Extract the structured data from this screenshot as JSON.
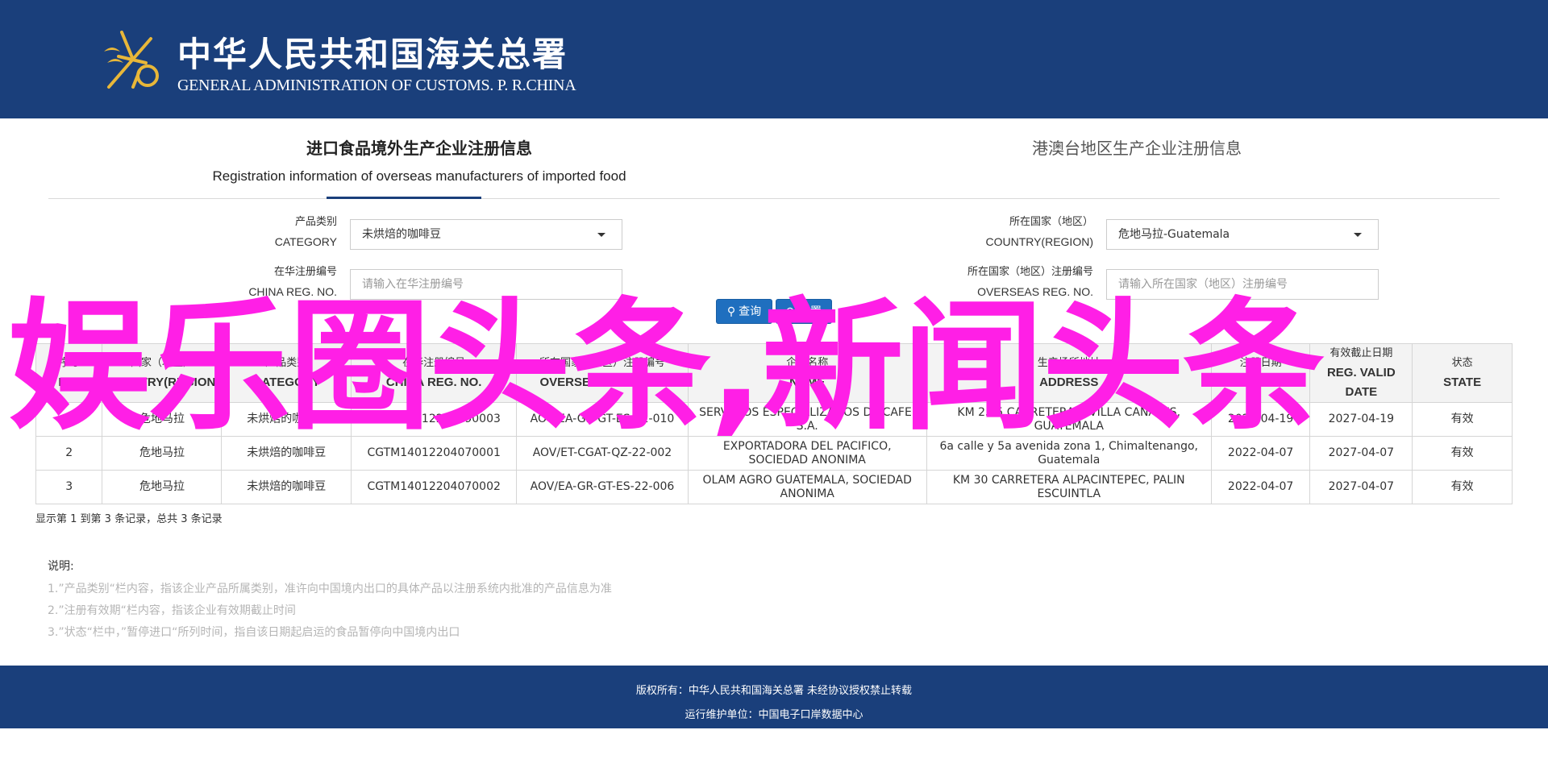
{
  "header": {
    "title_cn": "中华人民共和国海关总署",
    "title_en": "GENERAL ADMINISTRATION OF CUSTOMS. P. R.CHINA"
  },
  "tabs": [
    {
      "cn": "进口食品境外生产企业注册信息",
      "en": "Registration information of overseas manufacturers of imported food"
    },
    {
      "cn": "港澳台地区生产企业注册信息"
    }
  ],
  "form": {
    "category": {
      "label_cn": "产品类别",
      "label_en": "CATEGORY",
      "value": "未烘焙的咖啡豆"
    },
    "country": {
      "label_cn": "所在国家（地区）",
      "label_en": "COUNTRY(REGION)",
      "value": "危地马拉-Guatemala"
    },
    "china_reg": {
      "label_cn": "在华注册编号",
      "label_en": "CHINA REG. NO.",
      "placeholder": "请输入在华注册编号"
    },
    "overseas_reg": {
      "label_cn": "所在国家（地区）注册编号",
      "label_en": "OVERSEAS REG. NO.",
      "placeholder": "请输入所在国家（地区）注册编号"
    },
    "search_label": "查询",
    "reset_label": "重置"
  },
  "table": {
    "headers": [
      {
        "cn": "序号",
        "en": "NO."
      },
      {
        "cn": "国家（地区）",
        "en": "COUNTRY(REGION)"
      },
      {
        "cn": "产品类别",
        "en": "CATEGORY"
      },
      {
        "cn": "在华注册编号",
        "en": "CHINA REG. NO."
      },
      {
        "cn": "所在国家（地区）注册编号",
        "en": "OVERSEAS REG. NO."
      },
      {
        "cn": "企业名称",
        "en": "NAME"
      },
      {
        "cn": "生产场所地址",
        "en": "ADDRESS"
      },
      {
        "cn": "注册日期",
        "en": "REG. DATE"
      },
      {
        "cn": "有效截止日期",
        "en": "REG. VALID DATE"
      },
      {
        "cn": "状态",
        "en": "STATE"
      }
    ],
    "rows": [
      [
        "1",
        "危地马拉",
        "未烘焙的咖啡豆",
        "CGTM14012204190003",
        "AOV/EA-GR-GT-ES-22-010",
        "SERVICIOS ESPECIALIZADOS DE CAFE, S.A.",
        "KM 25.5 CARRETERA A VILLA CANALES, GUATEMALA",
        "2022-04-19",
        "2027-04-19",
        "有效"
      ],
      [
        "2",
        "危地马拉",
        "未烘焙的咖啡豆",
        "CGTM14012204070001",
        "AOV/ET-CGAT-QZ-22-002",
        "EXPORTADORA DEL PACIFICO, SOCIEDAD ANONIMA",
        "6a calle y 5a avenida zona 1, Chimaltenango, Guatemala",
        "2022-04-07",
        "2027-04-07",
        "有效"
      ],
      [
        "3",
        "危地马拉",
        "未烘焙的咖啡豆",
        "CGTM14012204070002",
        "AOV/EA-GR-GT-ES-22-006",
        "OLAM AGRO GUATEMALA, SOCIEDAD ANONIMA",
        "KM 30 CARRETERA ALPACINTEPEC, PALIN ESCUINTLA",
        "2022-04-07",
        "2027-04-07",
        "有效"
      ]
    ]
  },
  "record_info": "显示第 1 到第 3 条记录，总共 3 条记录",
  "notes": {
    "title": "说明:",
    "items": [
      "1.”产品类别“栏内容，指该企业产品所属类别，准许向中国境内出口的具体产品以注册系统内批准的产品信息为准",
      "2.”注册有效期“栏内容，指该企业有效期截止时间",
      "3.”状态“栏中，”暂停进口“所列时间，指自该日期起启运的食品暂停向中国境内出口"
    ]
  },
  "overlay_text": "娱乐圈头条,新闻头条",
  "footer": {
    "copyright": "版权所有：中华人民共和国海关总署 未经协议授权禁止转载",
    "maintainer": "运行维护单位：中国电子口岸数据中心"
  },
  "colors": {
    "header_bg": "#1a3f7b",
    "button": "#1f6fbf",
    "overlay": "#ff1fe6"
  }
}
